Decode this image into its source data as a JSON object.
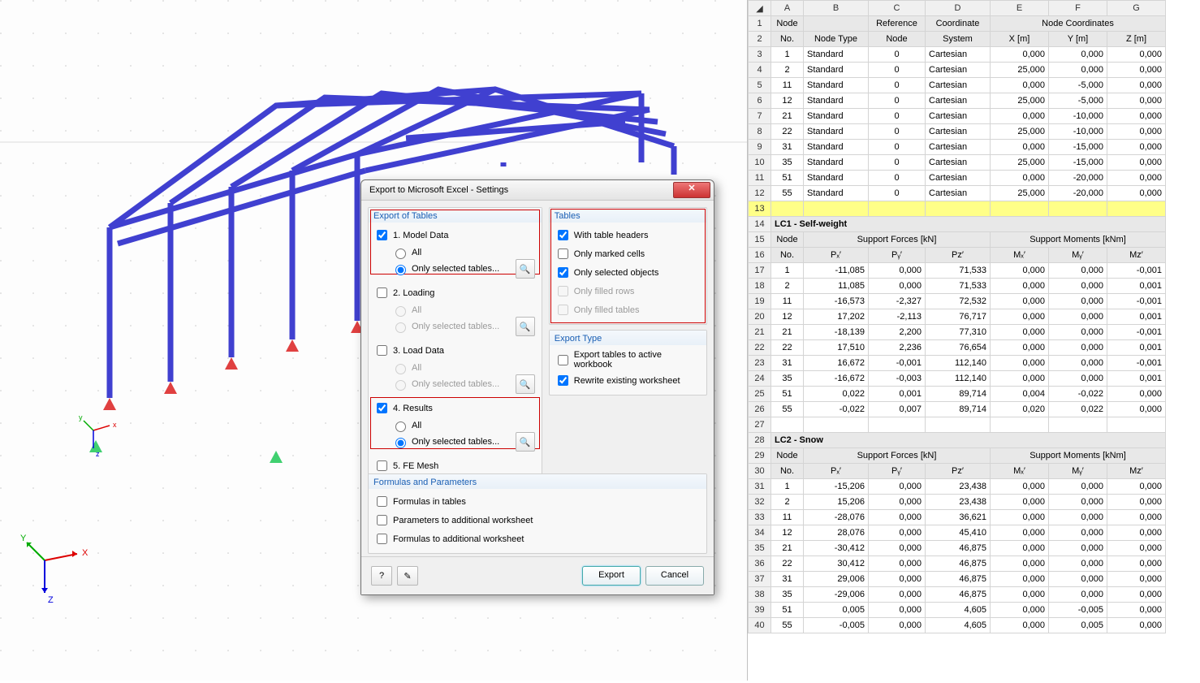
{
  "dialog": {
    "title": "Export to Microsoft Excel - Settings",
    "export_of_tables": "Export of Tables",
    "tables": "Tables",
    "export_type": "Export Type",
    "formulas_params": "Formulas and Parameters",
    "s1": "1. Model Data",
    "s2": "2. Loading",
    "s3": "3. Load Data",
    "s4": "4. Results",
    "s5": "5. FE Mesh",
    "all": "All",
    "only_sel": "Only selected tables...",
    "with_headers": "With table headers",
    "only_marked": "Only marked cells",
    "only_sel_obj": "Only selected objects",
    "only_filled_rows": "Only filled rows",
    "only_filled_tables": "Only filled tables",
    "export_active": "Export tables to active workbook",
    "rewrite": "Rewrite existing worksheet",
    "formulas_in": "Formulas in tables",
    "params_ws": "Parameters to additional worksheet",
    "formulas_ws": "Formulas to additional worksheet",
    "export_btn": "Export",
    "cancel_btn": "Cancel"
  },
  "sheet": {
    "cols": [
      "A",
      "B",
      "C",
      "D",
      "E",
      "F",
      "G"
    ],
    "nodes_header": {
      "node": "Node",
      "ref": "Reference",
      "coord": "Coordinate",
      "nc": "Node Coordinates",
      "no": "No.",
      "type": "Node Type",
      "refn": "Node",
      "sys": "System",
      "x": "X [m]",
      "y": "Y [m]",
      "z": "Z [m]"
    },
    "nodes": [
      {
        "no": 1,
        "type": "Standard",
        "ref": 0,
        "sys": "Cartesian",
        "x": "0,000",
        "y": "0,000",
        "z": "0,000"
      },
      {
        "no": 2,
        "type": "Standard",
        "ref": 0,
        "sys": "Cartesian",
        "x": "25,000",
        "y": "0,000",
        "z": "0,000"
      },
      {
        "no": 11,
        "type": "Standard",
        "ref": 0,
        "sys": "Cartesian",
        "x": "0,000",
        "y": "-5,000",
        "z": "0,000"
      },
      {
        "no": 12,
        "type": "Standard",
        "ref": 0,
        "sys": "Cartesian",
        "x": "25,000",
        "y": "-5,000",
        "z": "0,000"
      },
      {
        "no": 21,
        "type": "Standard",
        "ref": 0,
        "sys": "Cartesian",
        "x": "0,000",
        "y": "-10,000",
        "z": "0,000"
      },
      {
        "no": 22,
        "type": "Standard",
        "ref": 0,
        "sys": "Cartesian",
        "x": "25,000",
        "y": "-10,000",
        "z": "0,000"
      },
      {
        "no": 31,
        "type": "Standard",
        "ref": 0,
        "sys": "Cartesian",
        "x": "0,000",
        "y": "-15,000",
        "z": "0,000"
      },
      {
        "no": 35,
        "type": "Standard",
        "ref": 0,
        "sys": "Cartesian",
        "x": "25,000",
        "y": "-15,000",
        "z": "0,000"
      },
      {
        "no": 51,
        "type": "Standard",
        "ref": 0,
        "sys": "Cartesian",
        "x": "0,000",
        "y": "-20,000",
        "z": "0,000"
      },
      {
        "no": 55,
        "type": "Standard",
        "ref": 0,
        "sys": "Cartesian",
        "x": "25,000",
        "y": "-20,000",
        "z": "0,000"
      }
    ],
    "lc1": "LC1 - Self-weight",
    "lc2": "LC2 - Snow",
    "fhdr": {
      "node": "Node",
      "sf": "Support Forces [kN]",
      "sm": "Support Moments [kNm]",
      "no": "No.",
      "px": "Pₓ′",
      "py": "Pᵧ′",
      "pz": "Pᴢ′",
      "mx": "Mₓ′",
      "my": "Mᵧ′",
      "mz": "Mᴢ′"
    },
    "lc1rows": [
      {
        "no": 1,
        "px": "-11,085",
        "py": "0,000",
        "pz": "71,533",
        "mx": "0,000",
        "my": "0,000",
        "mz": "-0,001"
      },
      {
        "no": 2,
        "px": "11,085",
        "py": "0,000",
        "pz": "71,533",
        "mx": "0,000",
        "my": "0,000",
        "mz": "0,001"
      },
      {
        "no": 11,
        "px": "-16,573",
        "py": "-2,327",
        "pz": "72,532",
        "mx": "0,000",
        "my": "0,000",
        "mz": "-0,001"
      },
      {
        "no": 12,
        "px": "17,202",
        "py": "-2,113",
        "pz": "76,717",
        "mx": "0,000",
        "my": "0,000",
        "mz": "0,001"
      },
      {
        "no": 21,
        "px": "-18,139",
        "py": "2,200",
        "pz": "77,310",
        "mx": "0,000",
        "my": "0,000",
        "mz": "-0,001"
      },
      {
        "no": 22,
        "px": "17,510",
        "py": "2,236",
        "pz": "76,654",
        "mx": "0,000",
        "my": "0,000",
        "mz": "0,001"
      },
      {
        "no": 31,
        "px": "16,672",
        "py": "-0,001",
        "pz": "112,140",
        "mx": "0,000",
        "my": "0,000",
        "mz": "-0,001"
      },
      {
        "no": 35,
        "px": "-16,672",
        "py": "-0,003",
        "pz": "112,140",
        "mx": "0,000",
        "my": "0,000",
        "mz": "0,001"
      },
      {
        "no": 51,
        "px": "0,022",
        "py": "0,001",
        "pz": "89,714",
        "mx": "0,004",
        "my": "-0,022",
        "mz": "0,000"
      },
      {
        "no": 55,
        "px": "-0,022",
        "py": "0,007",
        "pz": "89,714",
        "mx": "0,020",
        "my": "0,022",
        "mz": "0,000"
      }
    ],
    "lc2rows": [
      {
        "no": 1,
        "px": "-15,206",
        "py": "0,000",
        "pz": "23,438",
        "mx": "0,000",
        "my": "0,000",
        "mz": "0,000"
      },
      {
        "no": 2,
        "px": "15,206",
        "py": "0,000",
        "pz": "23,438",
        "mx": "0,000",
        "my": "0,000",
        "mz": "0,000"
      },
      {
        "no": 11,
        "px": "-28,076",
        "py": "0,000",
        "pz": "36,621",
        "mx": "0,000",
        "my": "0,000",
        "mz": "0,000"
      },
      {
        "no": 12,
        "px": "28,076",
        "py": "0,000",
        "pz": "45,410",
        "mx": "0,000",
        "my": "0,000",
        "mz": "0,000"
      },
      {
        "no": 21,
        "px": "-30,412",
        "py": "0,000",
        "pz": "46,875",
        "mx": "0,000",
        "my": "0,000",
        "mz": "0,000"
      },
      {
        "no": 22,
        "px": "30,412",
        "py": "0,000",
        "pz": "46,875",
        "mx": "0,000",
        "my": "0,000",
        "mz": "0,000"
      },
      {
        "no": 31,
        "px": "29,006",
        "py": "0,000",
        "pz": "46,875",
        "mx": "0,000",
        "my": "0,000",
        "mz": "0,000"
      },
      {
        "no": 35,
        "px": "-29,006",
        "py": "0,000",
        "pz": "46,875",
        "mx": "0,000",
        "my": "0,000",
        "mz": "0,000"
      },
      {
        "no": 51,
        "px": "0,005",
        "py": "0,000",
        "pz": "4,605",
        "mx": "0,000",
        "my": "-0,005",
        "mz": "0,000"
      },
      {
        "no": 55,
        "px": "-0,005",
        "py": "0,000",
        "pz": "4,605",
        "mx": "0,000",
        "my": "0,005",
        "mz": "0,000"
      }
    ]
  }
}
